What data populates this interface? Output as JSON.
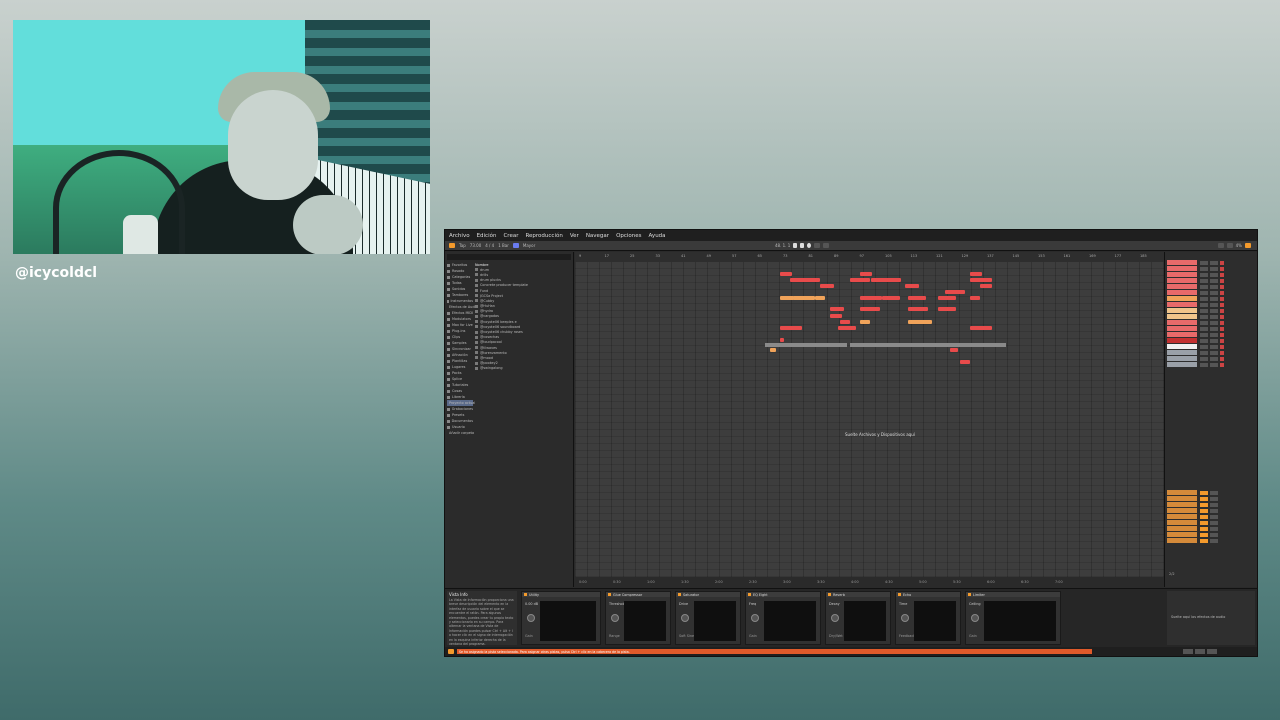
{
  "streamer": {
    "handle": "@icycoldcl"
  },
  "daw": {
    "menu": [
      "Archivo",
      "Edición",
      "Crear",
      "Reproducción",
      "Ver",
      "Navegar",
      "Opciones",
      "Ayuda"
    ],
    "transport": {
      "tap": "Tap",
      "tempo": "73.00",
      "signature": "4 / 4",
      "quantize": "1 Bar",
      "key": "Mayor",
      "position": "48. 1. 1",
      "cpu": "4%"
    },
    "browser": {
      "search_placeholder": "Buscar",
      "header": "Nombre",
      "categories": [
        "Favoritos",
        "Rosado",
        "Categorías",
        "Todas",
        "Sonidos",
        "Tambores",
        "Instrumentos",
        "Efectos de Audio",
        "Efectos MIDI",
        "Modulators",
        "Max for Live",
        "Plug-ins",
        "Clips",
        "Samples",
        "Sincronizar",
        "Afinación",
        "Plantillas",
        "Lugares",
        "Packs",
        "Splice",
        "Tutoriales",
        "Cosas",
        "Librería",
        "Proyecto actual",
        "Grabaciones",
        "Presets",
        "Documentos",
        "Usuario",
        "Añadir carpeta"
      ],
      "files": [
        "drum",
        "drills",
        "drum plucks",
        "Concrete producer template",
        "Fund",
        "JGCSa Project",
        "@Cubby",
        "@HuHan",
        "@hydro",
        "@cargadas",
        "@coyote06 beeples e",
        "@coyote06 soundboard",
        "@coyote06 chubby roses",
        "@cosechas",
        "@loudpacool",
        "@lilwaves",
        "@lorenzamento",
        "@mood",
        "@pookey2",
        "@swingalong"
      ]
    },
    "ruler_ticks": [
      "9",
      "17",
      "25",
      "33",
      "41",
      "49",
      "57",
      "65",
      "73",
      "81",
      "89",
      "97",
      "105",
      "113",
      "121",
      "129",
      "137",
      "145",
      "153",
      "161",
      "169",
      "177",
      "185"
    ],
    "time_ticks": [
      "0:00",
      "0:30",
      "1:00",
      "1:30",
      "2:00",
      "2:30",
      "3:00",
      "3:30",
      "4:00",
      "4:30",
      "5:00",
      "5:30",
      "6:00",
      "6:30",
      "7:00"
    ],
    "drop_hint": "Suelte Archivos y Dispositivos aquí",
    "page_counter": "2/2",
    "info_panel": {
      "title": "Vista Info",
      "body": "La Vista de Información proporciona una breve descripción del elemento en la interfaz de usuario sobre el que se encuentre el ratón. Para algunos elementos, puedes crear tu propio texto y seleccionarlo en su campo. Para alternar la ventana de Vista de Información puedes pulsar Ctrl + Alt + I o hacer clic en el signo de interrogación en la esquina inferior derecha de la ventana del programa."
    },
    "devices": [
      {
        "name": "Utility",
        "value": "0.00 dB",
        "sub": "Gain"
      },
      {
        "name": "Glue Compressor",
        "value": "Threshold",
        "sub": "Range"
      },
      {
        "name": "Saturator",
        "value": "Drive",
        "sub": "Soft Sine"
      },
      {
        "name": "EQ Eight",
        "value": "Freq",
        "sub": "Gain"
      },
      {
        "name": "Reverb",
        "value": "Decay",
        "sub": "Dry/Wet"
      },
      {
        "name": "Echo",
        "value": "Time",
        "sub": "Feedback"
      },
      {
        "name": "Limiter",
        "value": "Ceiling",
        "sub": "Gain"
      }
    ],
    "dropzone": "Suelte aquí los efectos de audio",
    "status": "Se ha asignado la pista seleccionada. Para asignar otras pistas, pulsa Ctrl + clic en la cabecera de la pista.",
    "colors": {
      "accent": "#f39a2c",
      "clip_red": "#e84b4b",
      "clip_orange": "#f0a35a",
      "status_orange": "#e05a2a"
    }
  }
}
